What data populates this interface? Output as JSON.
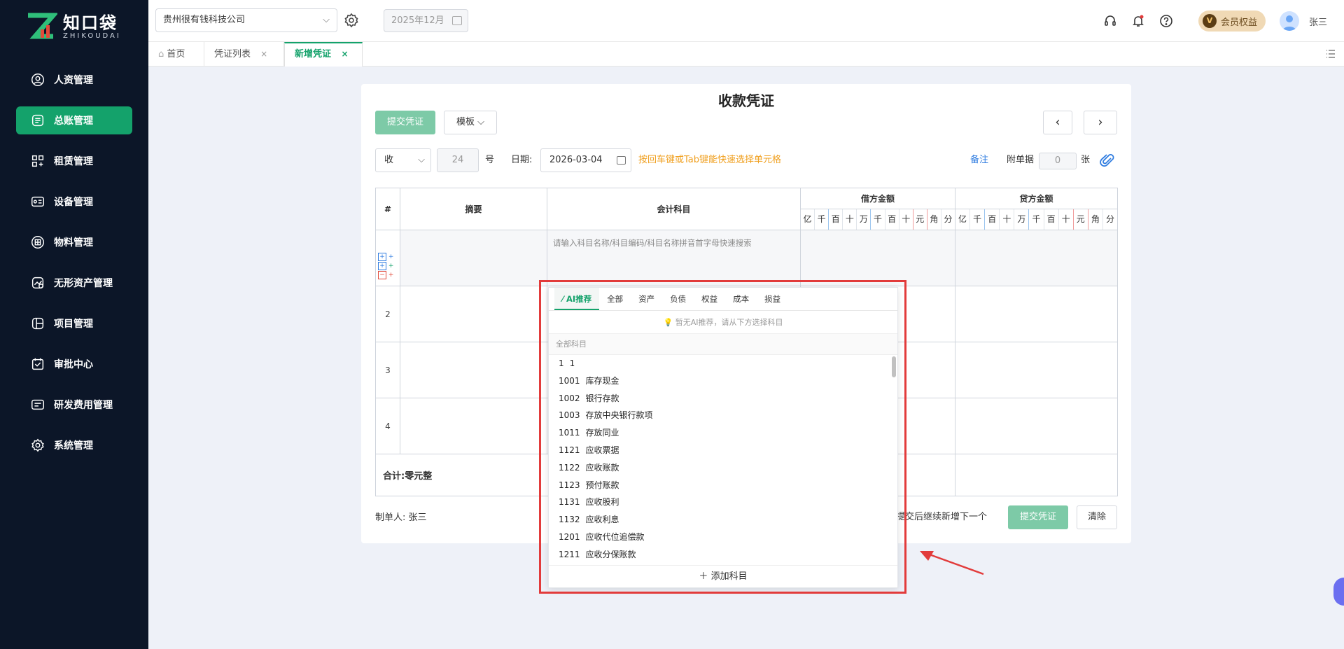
{
  "sidebar": {
    "logo_cn": "知口袋",
    "logo_en": "ZHIKOUDAI",
    "items": [
      {
        "label": "人资管理"
      },
      {
        "label": "总账管理"
      },
      {
        "label": "租赁管理"
      },
      {
        "label": "设备管理"
      },
      {
        "label": "物料管理"
      },
      {
        "label": "无形资产管理"
      },
      {
        "label": "项目管理"
      },
      {
        "label": "审批中心"
      },
      {
        "label": "研发费用管理"
      },
      {
        "label": "系统管理"
      }
    ],
    "active_index": 1
  },
  "header": {
    "company": "贵州很有钱科技公司",
    "period": "2025年12月",
    "vip_badge": "V",
    "vip_label": "会员权益",
    "username": "张三"
  },
  "tabs": [
    {
      "label": "首页"
    },
    {
      "label": "凭证列表",
      "close": "×"
    },
    {
      "label": "新增凭证",
      "close": "×"
    }
  ],
  "voucher": {
    "title": "收款凭证",
    "submit_label": "提交凭证",
    "template_label": "模板",
    "type_value": "收",
    "number": "24",
    "number_unit": "号",
    "date_label": "日期:",
    "date_value": "2026-03-04",
    "hint": "按回车键或Tab键能快速选择单元格",
    "remark_link": "备注",
    "attach_label": "附单据",
    "attach_count": "0",
    "attach_unit": "张",
    "table": {
      "col_index": "#",
      "col_summary": "摘要",
      "col_account": "会计科目",
      "col_debit": "借方金额",
      "col_credit": "贷方金额",
      "digit_units": [
        "亿",
        "千",
        "百",
        "十",
        "万",
        "千",
        "百",
        "十",
        "元",
        "角",
        "分"
      ],
      "account_placeholder": "请输入科目名称/科目编码/科目名称拼音首字母快速搜索",
      "rows": [
        "",
        "2",
        "3",
        "4"
      ],
      "total_label": "合计:零元整"
    },
    "maker_label": "制单人:",
    "maker_name": "张三",
    "continue_label": "提交后继续新增下一个",
    "submit_bottom": "提交凭证",
    "clear_label": "清除"
  },
  "popup": {
    "tabs": [
      "AI推荐",
      "全部",
      "资产",
      "负债",
      "权益",
      "成本",
      "损益"
    ],
    "notice": "暂无AI推荐，请从下方选择科目",
    "section": "全部科目",
    "items": [
      {
        "code": "1",
        "name": "1"
      },
      {
        "code": "1001",
        "name": "库存现金"
      },
      {
        "code": "1002",
        "name": "银行存款"
      },
      {
        "code": "1003",
        "name": "存放中央银行款项"
      },
      {
        "code": "1011",
        "name": "存放同业"
      },
      {
        "code": "1121",
        "name": "应收票据"
      },
      {
        "code": "1122",
        "name": "应收账款"
      },
      {
        "code": "1123",
        "name": "预付账款"
      },
      {
        "code": "1131",
        "name": "应收股利"
      },
      {
        "code": "1132",
        "name": "应收利息"
      },
      {
        "code": "1201",
        "name": "应收代位追偿款"
      },
      {
        "code": "1211",
        "name": "应收分保账款"
      }
    ],
    "add_label": "添加科目"
  },
  "colors": {
    "brand": "#14a26b",
    "highlight": "#e23b3b",
    "hint": "#f0a020"
  }
}
